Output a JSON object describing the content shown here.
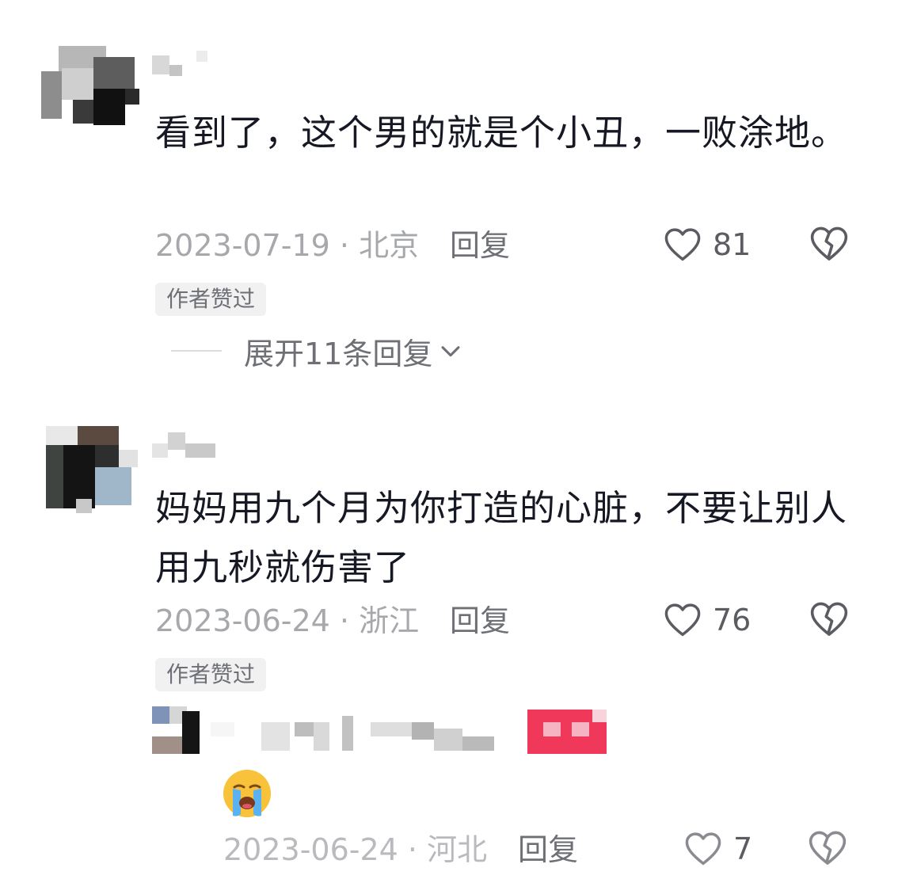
{
  "comments": [
    {
      "text": "看到了，这个男的就是个小丑，一败涂地。",
      "date_location": "2023-07-19 · 北京",
      "reply_label": "回复",
      "likes": "81",
      "tag": "作者赞过",
      "expand_label": "展开11条回复"
    },
    {
      "text": "妈妈用九个月为你打造的心脏，不要让别人用九秒就伤害了",
      "date_location": "2023-06-24 · 浙江",
      "reply_label": "回复",
      "likes": "76",
      "tag": "作者赞过"
    }
  ],
  "sub_reply": {
    "emoji": "loudly-crying-face",
    "date_location": "2023-06-24 · 河北",
    "reply_label": "回复",
    "likes": "7"
  },
  "colors": {
    "text": "#161823",
    "meta": "#a7a8ac",
    "tag_bg": "#f1f1f2",
    "badge": "#f0395a"
  }
}
